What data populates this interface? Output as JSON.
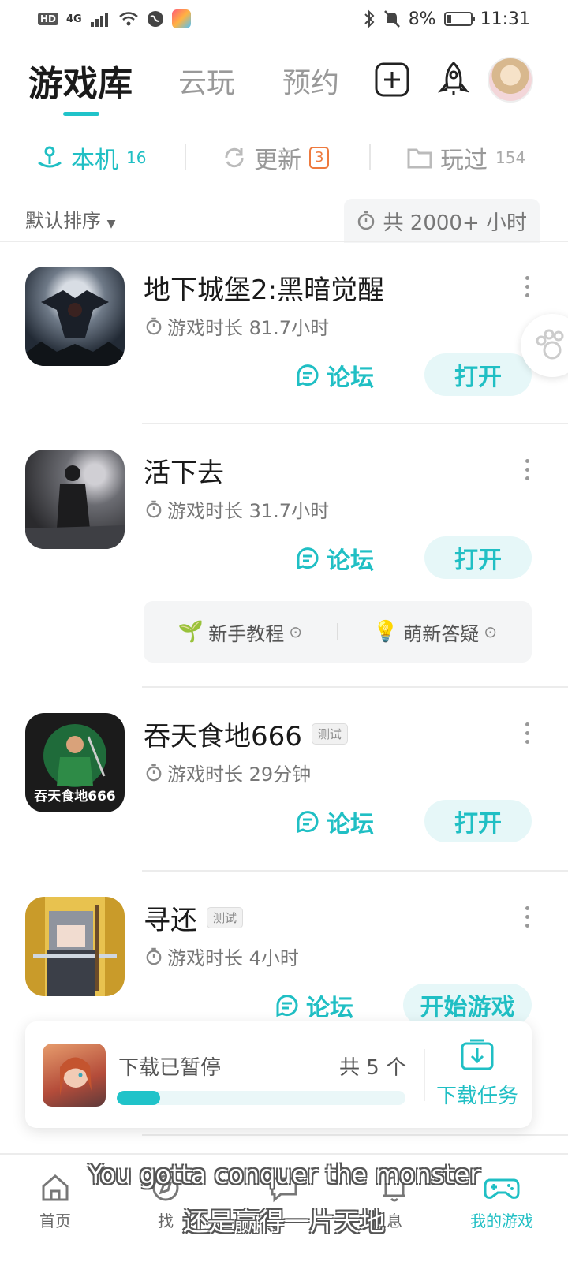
{
  "status_bar": {
    "hd": "HD",
    "network": "4G",
    "battery_percent": "8%",
    "time": "11:31"
  },
  "header": {
    "tabs": [
      {
        "label": "游戏库",
        "active": true
      },
      {
        "label": "云玩",
        "active": false
      },
      {
        "label": "预约",
        "active": false
      }
    ]
  },
  "filters": {
    "local": {
      "label": "本机",
      "count": "16"
    },
    "updates": {
      "label": "更新",
      "count": "3"
    },
    "played": {
      "label": "玩过",
      "count": "154"
    }
  },
  "sort": {
    "label": "默认排序",
    "total_time": "共 2000+ 小时"
  },
  "games": [
    {
      "title": "地下城堡2:黑暗觉醒",
      "tag": "",
      "time": "游戏时长 81.7小时",
      "forum": "论坛",
      "action": "打开"
    },
    {
      "title": "活下去",
      "tag": "",
      "time": "游戏时长 31.7小时",
      "forum": "论坛",
      "action": "打开",
      "guides": [
        {
          "label": "新手教程"
        },
        {
          "label": "萌新答疑"
        }
      ]
    },
    {
      "title": "吞天食地666",
      "tag": "测试",
      "time": "游戏时长 29分钟",
      "forum": "论坛",
      "action": "打开",
      "icon_text": "吞天食地666"
    },
    {
      "title": "寻还",
      "tag": "测试",
      "time": "游戏时长 4小时",
      "forum": "论坛",
      "action": "开始游戏"
    }
  ],
  "download": {
    "status": "下载已暂停",
    "count": "共 5 个",
    "progress": 0.15,
    "task_label": "下载任务"
  },
  "bottom_nav": [
    {
      "label": "首页",
      "icon": "home-icon"
    },
    {
      "label": "找",
      "icon": "discover-icon"
    },
    {
      "label": "",
      "icon": "chat-icon"
    },
    {
      "label": "息",
      "icon": "bell-icon"
    },
    {
      "label": "我的游戏",
      "icon": "gamepad-icon",
      "active": true
    }
  ],
  "subtitles": {
    "english": "You gotta conquer the monster",
    "chinese": "还是赢得一片天地"
  },
  "colors": {
    "accent": "#20bfc4",
    "badge": "#ee7a3e"
  }
}
